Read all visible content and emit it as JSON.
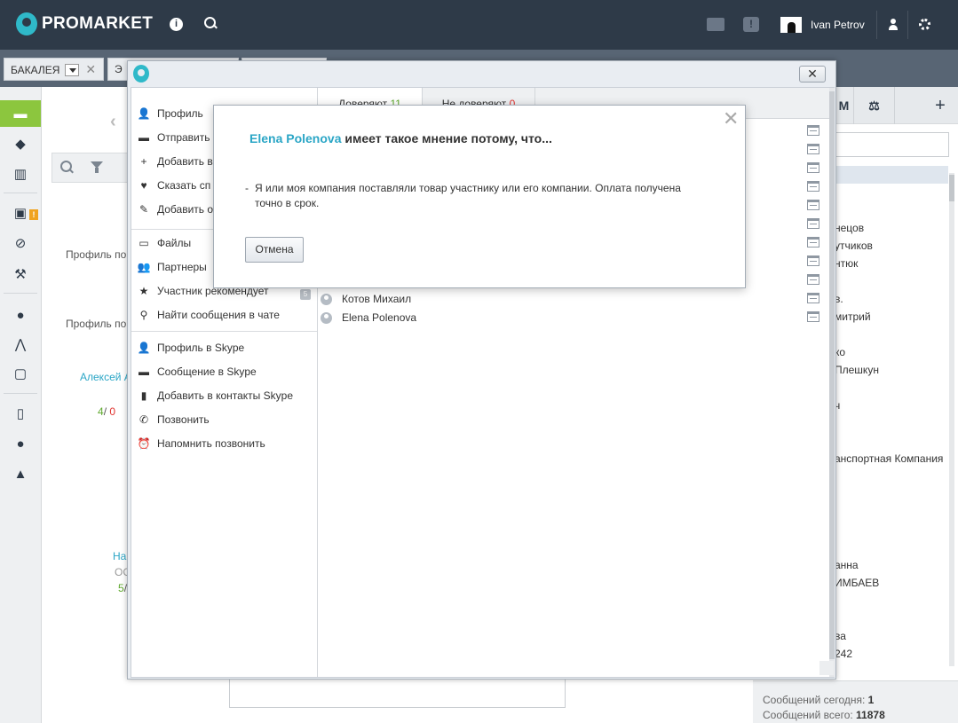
{
  "header": {
    "logo_text": "PROMARKET",
    "info_icon_glyph": "i",
    "alert_icon_glyph": "!",
    "user_name": "Ivan Petrov"
  },
  "tabs": [
    {
      "label": "БАКАЛЕЯ",
      "close": "✕"
    },
    {
      "label": "Э"
    }
  ],
  "sidebar": {
    "badge": "!",
    "icons": [
      "chat-icon",
      "tag-icon",
      "books-icon",
      "clipboard-icon",
      "ban-icon",
      "worker-icon",
      "conversation-icon",
      "compass-icon",
      "tv-icon",
      "book-icon",
      "map-marker-icon",
      "user-icon"
    ]
  },
  "background": {
    "profile_label_1": "Профиль по",
    "profile_label_2": "Профиль по",
    "person_link": "Алексей А",
    "rating_green": "4",
    "rating_sep": "/ ",
    "rating_red": "0",
    "link_2": "На",
    "text_2": "ОС",
    "rating_green_2": "5",
    "rating_sep_2": "/",
    "right_list": [
      "нецов",
      "утчиков",
      "нтюк",
      "в.",
      "митрий",
      "ко",
      "Плешкун",
      "ч",
      "анспортная Компания",
      "анна",
      "ИМБАЕВ",
      "ва",
      "242"
    ],
    "stats": {
      "today_label": "Сообщений сегодня: ",
      "today_value": "1",
      "total_label": "Сообщений всего: ",
      "total_value": "11878"
    }
  },
  "window": {
    "close_glyph": "✕",
    "menu_group_1": [
      {
        "icon": "person-icon",
        "glyph": "👤",
        "label": "Профиль"
      },
      {
        "icon": "message-icon",
        "glyph": "▬",
        "label": "Отправить"
      },
      {
        "icon": "add-user-icon",
        "glyph": "+",
        "label": "Добавить в"
      },
      {
        "icon": "heart-icon",
        "glyph": "♥",
        "label": "Сказать сп"
      },
      {
        "icon": "pencil-icon",
        "glyph": "✎",
        "label": "Добавить о"
      }
    ],
    "menu_group_2": [
      {
        "icon": "folder-icon",
        "glyph": "▭",
        "label": "Файлы"
      },
      {
        "icon": "partners-icon",
        "glyph": "👥",
        "label": "Партнеры"
      },
      {
        "icon": "star-icon",
        "glyph": "★",
        "label": "Участник рекомендует"
      },
      {
        "icon": "search-icon",
        "glyph": "⚲",
        "label": "Найти сообщения в чате"
      }
    ],
    "menu_group_3": [
      {
        "icon": "person-icon",
        "glyph": "👤",
        "label": "Профиль в Skype"
      },
      {
        "icon": "message-icon",
        "glyph": "▬",
        "label": "Сообщение в Skype"
      },
      {
        "icon": "contacts-book-icon",
        "glyph": "▮",
        "label": "Добавить в контакты Skype"
      },
      {
        "icon": "phone-icon",
        "glyph": "✆",
        "label": "Позвонить"
      },
      {
        "icon": "alarm-clock-icon",
        "glyph": "⏰",
        "label": "Напомнить позвонить"
      }
    ],
    "recommend_badge": "5",
    "trust_tabs": [
      {
        "label": "Доверяют ",
        "count": "11"
      },
      {
        "label": "Не доверяют ",
        "count": "0"
      }
    ],
    "people": [
      "Котов Михаил",
      "Elena Polenova"
    ]
  },
  "dialog": {
    "close_glyph": "✕",
    "name": "Elena Polenova",
    "title_rest": " имеет такое мнение потому, что...",
    "bullet": "-",
    "reason": "Я или моя компания поставляли товар участнику или его компании. Оплата получена точно в срок.",
    "cancel_label": "Отмена"
  },
  "colors": {
    "topbar": "#2e3a48",
    "accent_teal": "#2fb9c9",
    "active_green": "#8cc63e",
    "link": "#2ba6c6",
    "positive": "#5ea82d",
    "negative": "#e0322e"
  }
}
